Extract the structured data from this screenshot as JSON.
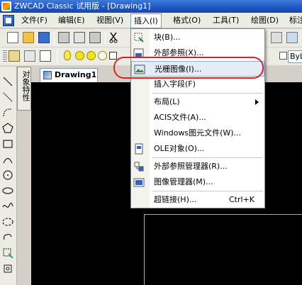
{
  "window": {
    "title": "ZWCAD Classic 试用版 - [Drawing1]"
  },
  "menubar": {
    "items": [
      {
        "label": "文件(F)"
      },
      {
        "label": "编辑(E)"
      },
      {
        "label": "视图(V)"
      },
      {
        "label": "插入(I)"
      },
      {
        "label": "格式(O)"
      },
      {
        "label": "工具(T)"
      },
      {
        "label": "绘图(D)"
      },
      {
        "label": "标注"
      }
    ],
    "active_index": 3
  },
  "toolbar": {
    "linetype_value": "ByL"
  },
  "properties_panel": {
    "label": "对象特性"
  },
  "drawing": {
    "tab_label": "Drawing1"
  },
  "insert_menu": {
    "items": [
      {
        "label": "块(B)...",
        "icon": "block-icon",
        "shortcut": ""
      },
      {
        "label": "外部参照(X)...",
        "icon": "xref-icon",
        "shortcut": ""
      },
      {
        "label": "光栅图像(I)...",
        "icon": "raster-image-icon",
        "shortcut": "",
        "highlighted": true
      },
      {
        "label": "插入字段(F)",
        "icon": "",
        "shortcut": ""
      },
      {
        "label": "布局(L)",
        "icon": "",
        "shortcut": "",
        "submenu": true
      },
      {
        "label": "ACIS文件(A)...",
        "icon": "",
        "shortcut": ""
      },
      {
        "label": "Windows图元文件(W)...",
        "icon": "",
        "shortcut": ""
      },
      {
        "label": "OLE对象(O)...",
        "icon": "ole-icon",
        "shortcut": ""
      },
      {
        "label": "外部参照管理器(R)...",
        "icon": "xref-manager-icon",
        "shortcut": ""
      },
      {
        "label": "图像管理器(M)...",
        "icon": "image-manager-icon",
        "shortcut": ""
      },
      {
        "label": "超链接(H)...",
        "icon": "",
        "shortcut": "Ctrl+K"
      }
    ]
  },
  "colors": {
    "highlight": "#e4ecf8",
    "annotation_circle": "#e0202a",
    "canvas": "#000000"
  }
}
